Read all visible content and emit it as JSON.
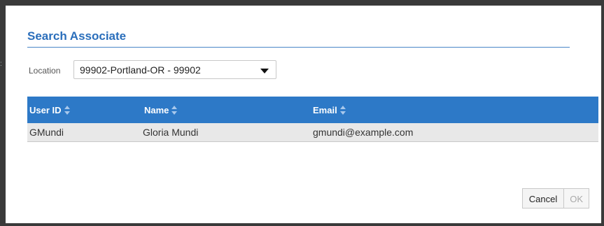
{
  "dialog": {
    "title": "Search Associate",
    "location_label": "Location",
    "location_value": "99902-Portland-OR - 99902"
  },
  "grid": {
    "columns": [
      "User ID",
      "Name",
      "Email"
    ],
    "rows": [
      {
        "user_id": "GMundi",
        "name": "Gloria Mundi",
        "email": "gmundi@example.com"
      }
    ]
  },
  "buttons": {
    "cancel": "Cancel",
    "ok": "OK"
  },
  "colors": {
    "title": "#2a6ebb",
    "header": "#2d79c7"
  }
}
